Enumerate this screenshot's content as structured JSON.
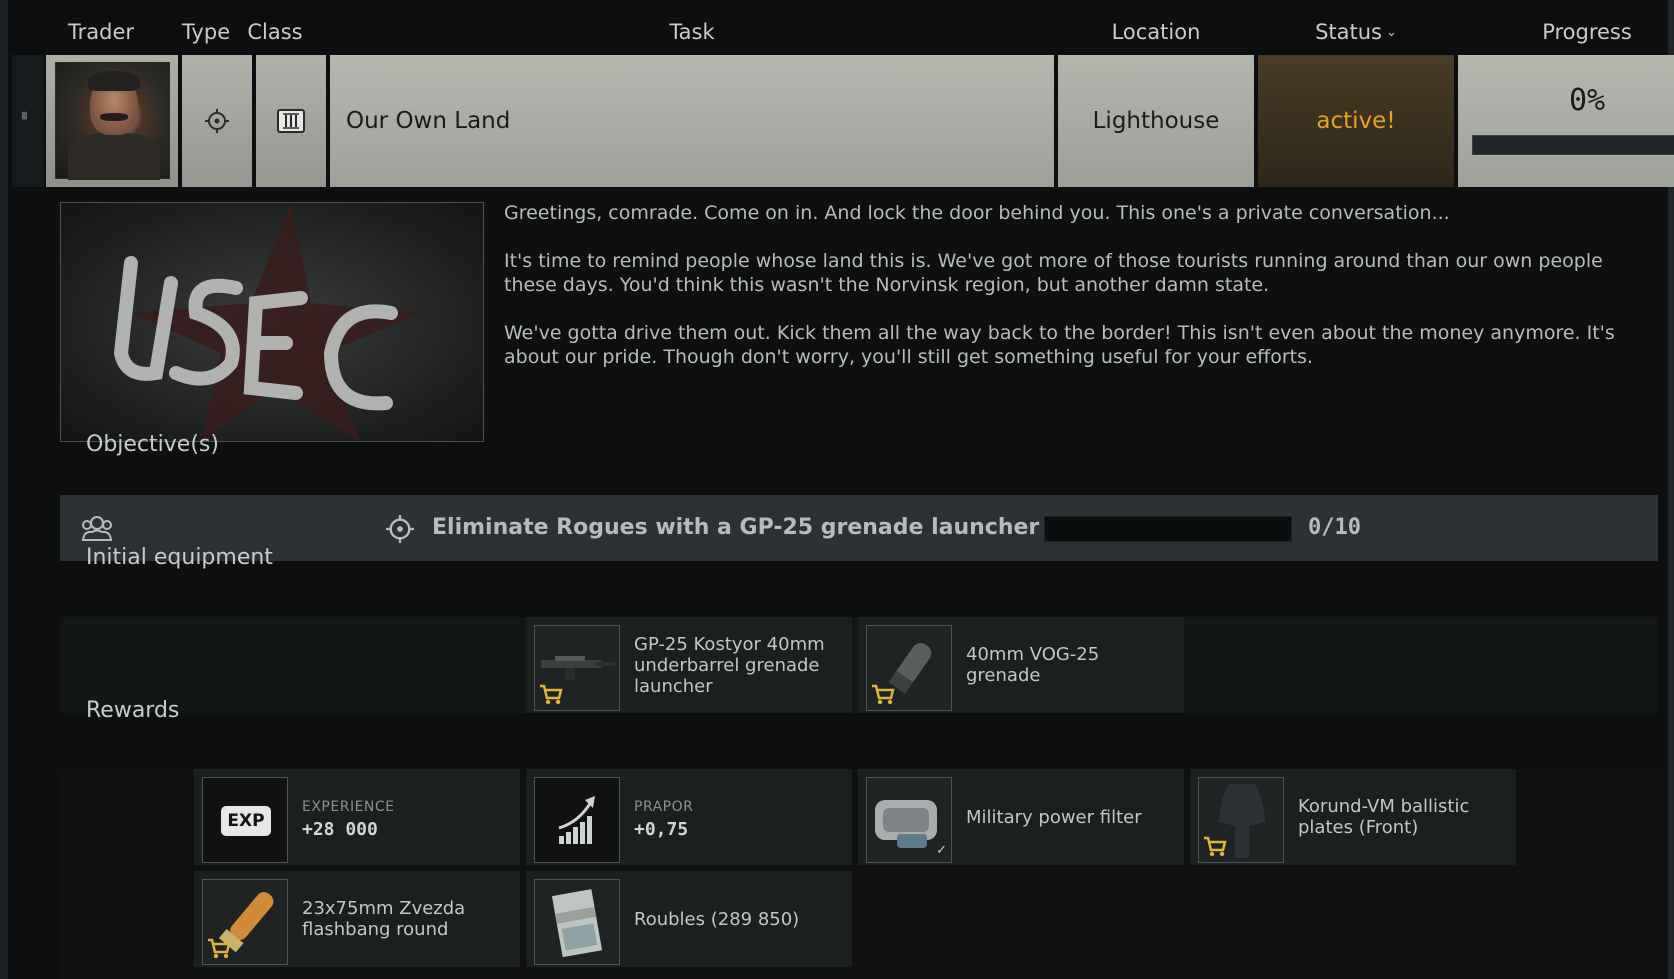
{
  "header": {
    "trader": "Trader",
    "type": "Type",
    "class": "Class",
    "task": "Task",
    "location": "Location",
    "status": "Status",
    "progress": "Progress"
  },
  "quest": {
    "trader_icon": "trader-portrait",
    "type_icon": "crosshair-icon",
    "class_icon": "roman-three-icon",
    "name": "Our Own Land",
    "location": "Lighthouse",
    "status": "active!",
    "status_color": "#e3a126",
    "progress_text": "0%",
    "progress_fraction": 0
  },
  "description": {
    "paragraphs": [
      "Greetings, comrade. Come on in. And lock the door behind you. This one's a private conversation...",
      "It's time to remind people whose land this is. We've got more of those tourists running around than our own people these days. You'd think this wasn't the Norvinsk region, but another damn state.",
      "We've gotta drive them out. Kick them all the way back to the border! This isn't even about the money anymore. It's about our pride. Though don't worry, you'll still get something useful for your efforts."
    ]
  },
  "objectives": {
    "title": "Objective(s)",
    "items": [
      {
        "text": "Eliminate Rogues with a GP-25 grenade launcher",
        "count": "0/10",
        "progress_fraction": 0
      }
    ]
  },
  "initial_equipment": {
    "title": "Initial equipment",
    "items": [
      {
        "name": "GP-25 Kostyor 40mm underbarrel grenade launcher",
        "icon": "grenade-launcher-icon"
      },
      {
        "name": "40mm VOG-25 grenade",
        "icon": "grenade-icon"
      }
    ]
  },
  "rewards": {
    "title": "Rewards",
    "experience": {
      "label": "EXPERIENCE",
      "value": "+28 000",
      "badge": "EXP"
    },
    "reputation": {
      "label": "PRAPOR",
      "value": "+0,75"
    },
    "items": [
      {
        "name": "Military power filter",
        "icon": "power-filter-icon"
      },
      {
        "name": "Korund-VM ballistic plates (Front)",
        "icon": "ballistic-plate-icon"
      },
      {
        "name": "23x75mm Zvezda flashbang round",
        "icon": "shotgun-shell-icon"
      },
      {
        "name": "Roubles (289 850)",
        "icon": "roubles-icon"
      }
    ]
  },
  "colors": {
    "accent": "#e3a126",
    "cart": "#e0b43a"
  }
}
